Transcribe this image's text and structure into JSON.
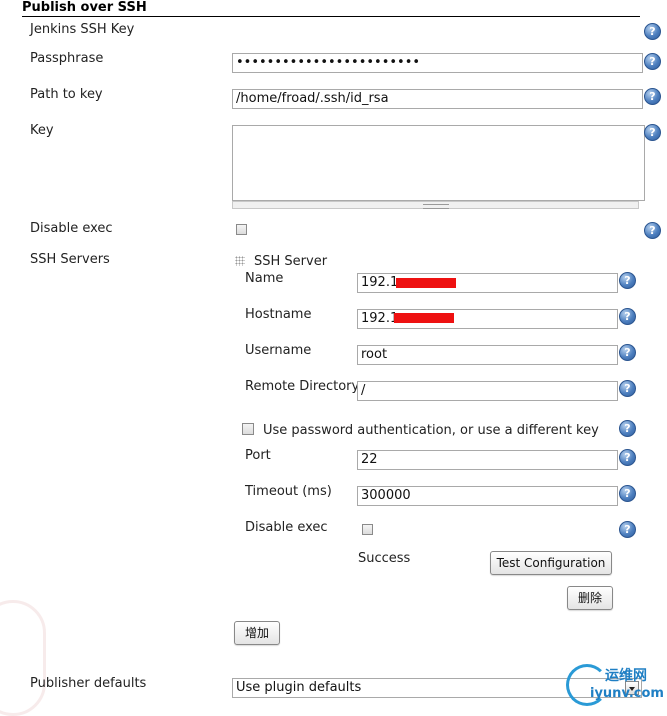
{
  "section": {
    "title": "Publish over SSH"
  },
  "jenkins_ssh_key": {
    "label": "Jenkins SSH Key"
  },
  "passphrase": {
    "label": "Passphrase",
    "value": "••••••••••••••••••••••••"
  },
  "path_to_key": {
    "label": "Path to key",
    "value": "/home/froad/.ssh/id_rsa"
  },
  "key": {
    "label": "Key",
    "value": ""
  },
  "disable_exec": {
    "label": "Disable exec",
    "checked": false
  },
  "ssh_servers": {
    "label": "SSH Servers"
  },
  "ssh_server": {
    "header": "SSH Server",
    "name_label": "Name",
    "name_value": "192.1",
    "hostname_label": "Hostname",
    "hostname_value": "192.1",
    "username_label": "Username",
    "username_value": "root",
    "remote_dir_label": "Remote Directory",
    "remote_dir_value": "/",
    "use_password_label": "Use password authentication, or use a different key",
    "port_label": "Port",
    "port_value": "22",
    "timeout_label": "Timeout (ms)",
    "timeout_value": "300000",
    "disable_exec_label": "Disable exec",
    "status_text": "Success",
    "test_button": "Test Configuration",
    "delete_button": "删除"
  },
  "add_button": "增加",
  "publisher_defaults": {
    "label": "Publisher defaults",
    "value": "Use plugin defaults"
  },
  "help_icon_glyph": "?",
  "watermark": {
    "cn": "运维网",
    "en": "iyunv.com"
  },
  "colors": {
    "help_icon": "#3b6fb0",
    "redaction": "#ee1111",
    "watermark": "#1f7fc4"
  }
}
